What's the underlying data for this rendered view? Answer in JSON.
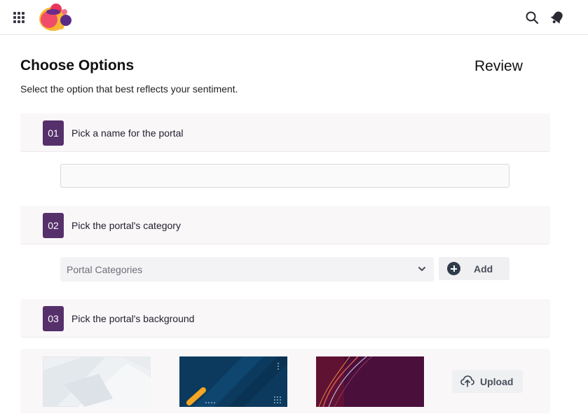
{
  "header": {
    "apps_icon": "grid-icon",
    "logo": "brand-logo",
    "search_icon": "search-icon",
    "notifications_icon": "bell-icon"
  },
  "page": {
    "title": "Choose Options",
    "review_title": "Review",
    "subtitle": "Select the option that best reflects your sentiment."
  },
  "steps": [
    {
      "number": "01",
      "label": "Pick a name for the portal"
    },
    {
      "number": "02",
      "label": "Pick the portal's category"
    },
    {
      "number": "03",
      "label": "Pick the portal's background"
    }
  ],
  "name_input": {
    "value": "",
    "placeholder": ""
  },
  "category": {
    "placeholder": "Portal Categories",
    "add_label": "Add"
  },
  "backgrounds": {
    "upload_label": "Upload",
    "options": [
      "light-geometric",
      "dark-blue-stripes",
      "maroon-waves"
    ]
  },
  "colors": {
    "accent": "#55306b",
    "step_bg": "#faf7f9",
    "button_bg": "#f0f0f2"
  }
}
